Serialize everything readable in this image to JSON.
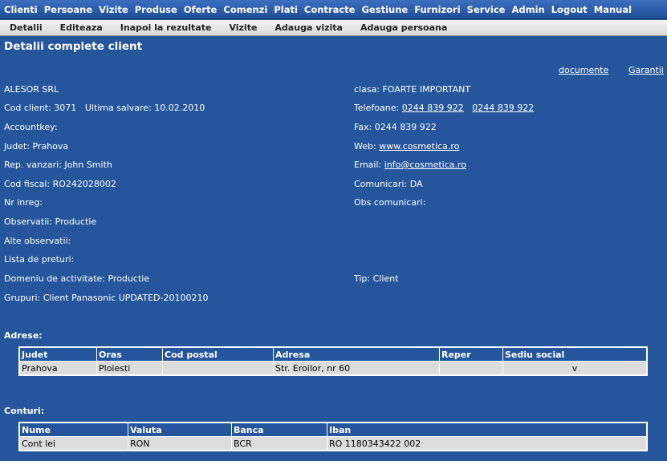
{
  "menu": [
    "Clienti",
    "Persoane",
    "Vizite",
    "Produse",
    "Oferte",
    "Comenzi",
    "Plati",
    "Contracte",
    "Gestiune",
    "Furnizori",
    "Service",
    "Admin",
    "Logout",
    "Manual"
  ],
  "submenu": [
    "Detalii",
    "Editeaza",
    "Inapoi la rezultate",
    "Vizite",
    "Adauga vizita",
    "Adauga persoana"
  ],
  "page_title": "Detalii complete client",
  "top_links": {
    "documente": "documente",
    "garantii": "Garantii"
  },
  "client": {
    "name": "ALESOR SRL",
    "cod_client": "Cod client: 3071",
    "ultima_salvare": "Ultima salvare: 10.02.2010",
    "accountkey": "Accountkey:",
    "judet": "Judet: Prahova",
    "rep_vanzari": "Rep. vanzari: John Smith",
    "cod_fiscal": "Cod fiscal: RO242028002",
    "nr_inreg": "Nr inreg:",
    "observatii": "Observatii: Productie",
    "alte_observatii": "Alte observatii:",
    "lista_preturi": "Lista de preturi:",
    "domeniu": "Domeniu de activitate: Productie",
    "grupuri": "Grupuri: Client Panasonic  UPDATED-20100210",
    "clasa": "clasa: FOARTE IMPORTANT",
    "telefoane_label": "Telefoane:",
    "telefon1": "0244 839 922",
    "telefon2": "0244 839 922",
    "fax": "Fax: 0244 839 922",
    "web_label": "Web:",
    "web": "www.cosmetica.ro",
    "email_label": "Email:",
    "email": "info@cosmetica.ro",
    "comunicari": "Comunicari: DA",
    "obs_comunicari": "Obs comunicari:",
    "tip": "Tip: Client"
  },
  "adrese": {
    "title": "Adrese:",
    "headers": [
      "Judet",
      "Oras",
      "Cod postal",
      "Adresa",
      "Reper",
      "Sediu social"
    ],
    "rows": [
      [
        "Prahova",
        "Ploiesti",
        "",
        "Str. Eroilor, nr 60",
        "",
        "v"
      ]
    ]
  },
  "conturi": {
    "title": "Conturi:",
    "headers": [
      "Nume",
      "Valuta",
      "Banca",
      "Iban"
    ],
    "rows": [
      [
        "Cont lei",
        "RON",
        "BCR",
        "RO 1180343422 002"
      ]
    ]
  }
}
